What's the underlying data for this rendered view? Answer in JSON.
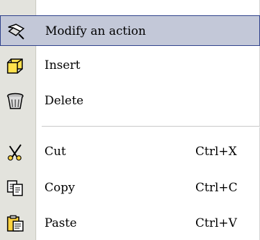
{
  "menu": {
    "items": [
      {
        "label": "Modify an action",
        "icon": "edit-action-icon"
      },
      {
        "label": "Insert",
        "icon": "insert-icon"
      },
      {
        "label": "Delete",
        "icon": "trash-icon"
      },
      {
        "label": "Cut",
        "shortcut": "Ctrl+X",
        "icon": "scissors-icon"
      },
      {
        "label": "Copy",
        "shortcut": "Ctrl+C",
        "icon": "copy-icon"
      },
      {
        "label": "Paste",
        "shortcut": "Ctrl+V",
        "icon": "paste-icon"
      }
    ]
  },
  "colors": {
    "highlight": "#c3c8d8",
    "highlight_border": "#2b3e8a",
    "gutter": "#e3e3dd"
  }
}
